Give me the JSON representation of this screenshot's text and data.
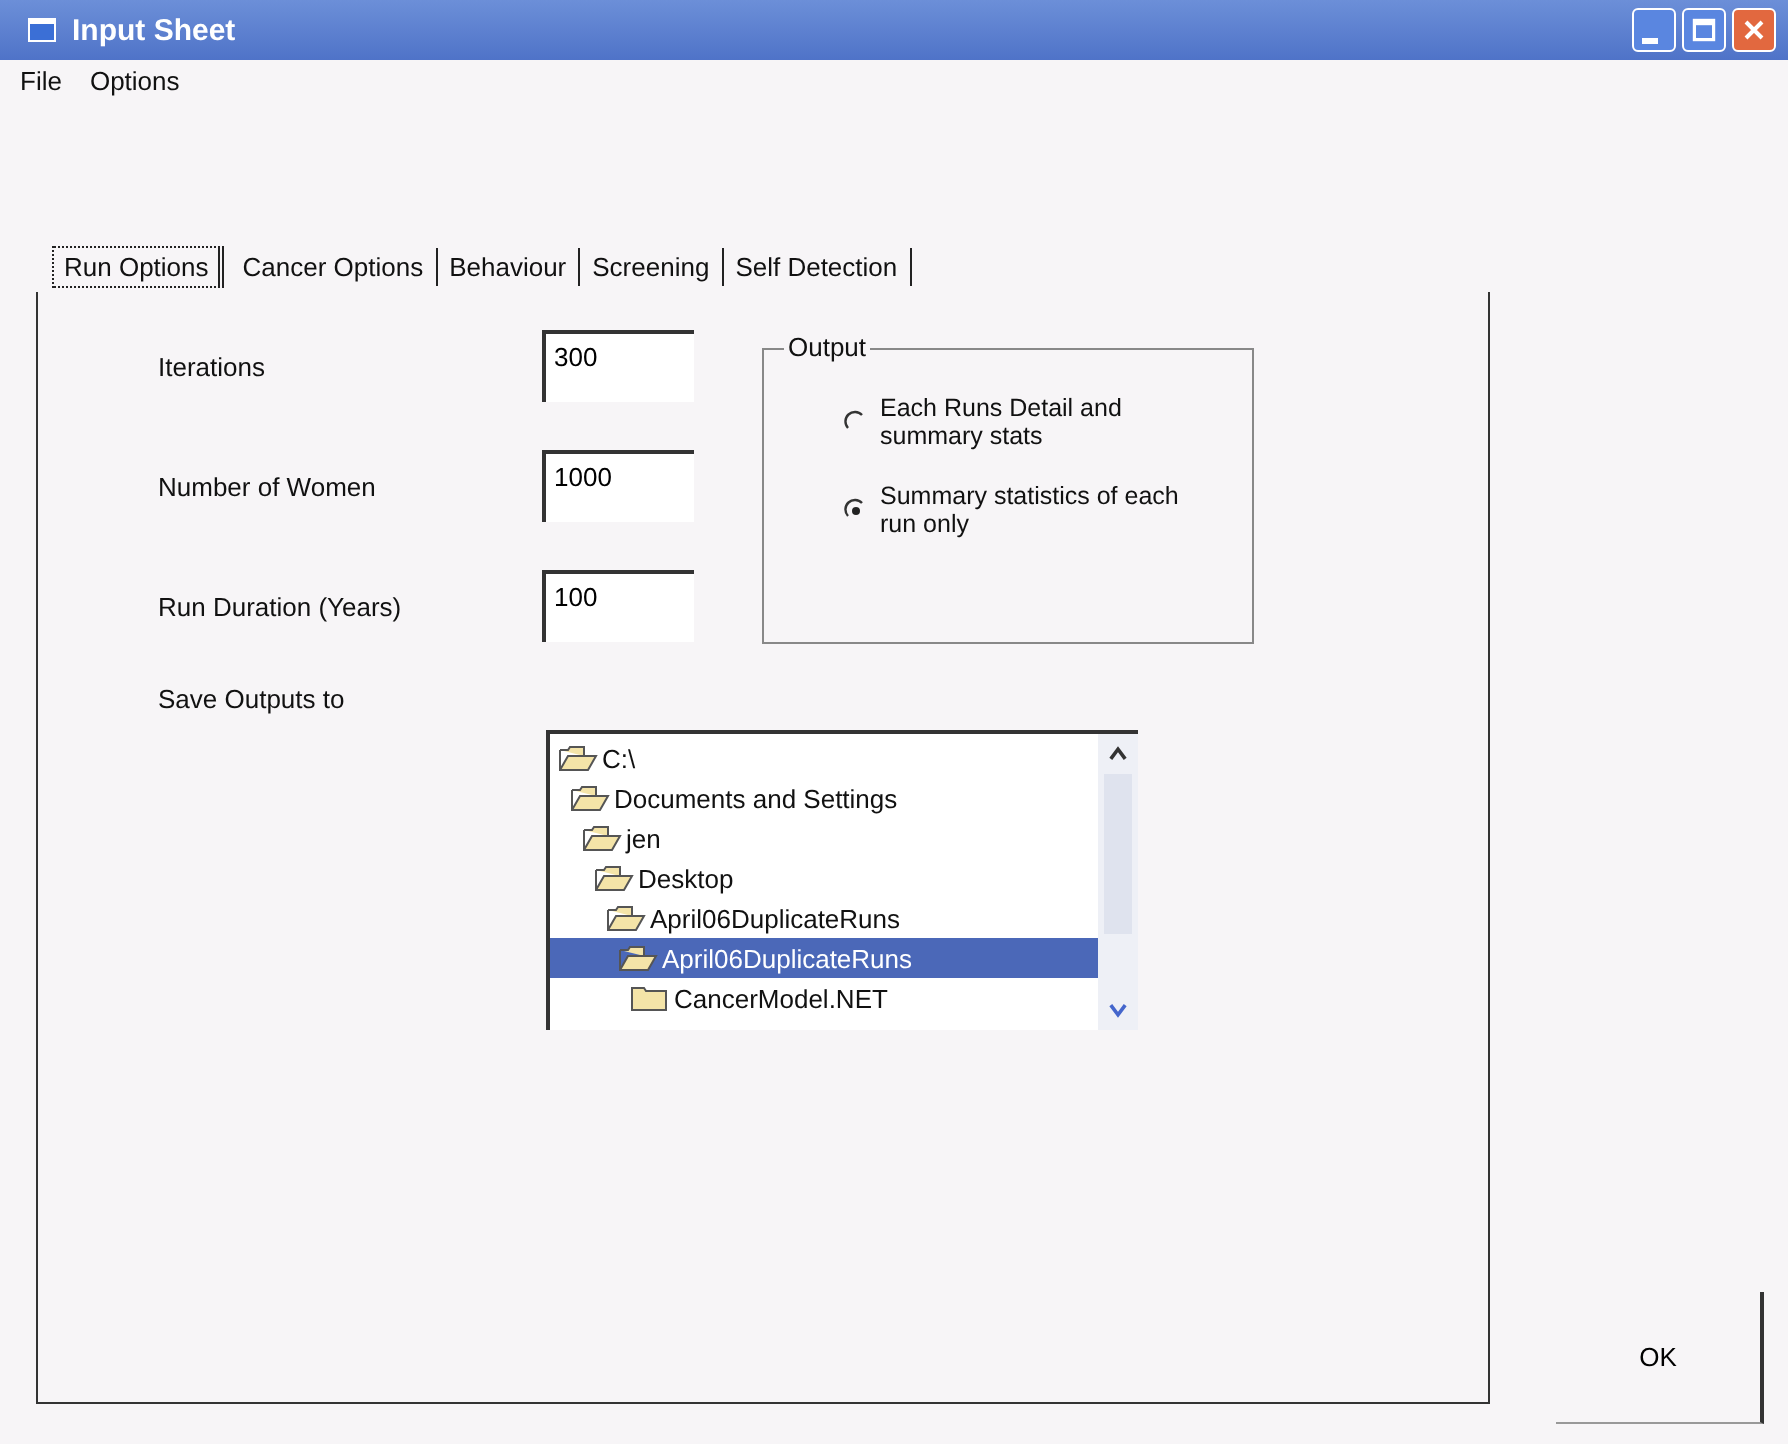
{
  "window": {
    "title": "Input Sheet"
  },
  "menu": [
    "File",
    "Options"
  ],
  "tabs": [
    {
      "label": "Run Options",
      "selected": true
    },
    {
      "label": "Cancer Options",
      "selected": false
    },
    {
      "label": "Behaviour",
      "selected": false
    },
    {
      "label": "Screening",
      "selected": false
    },
    {
      "label": "Self Detection",
      "selected": false
    }
  ],
  "fields": [
    {
      "label": "Iterations",
      "value": "300"
    },
    {
      "label": "Number of Women",
      "value": "1000"
    },
    {
      "label": "Run Duration (Years)",
      "value": "100"
    }
  ],
  "output": {
    "title": "Output",
    "options": [
      {
        "label": "Each Runs Detail and summary stats",
        "selected": false
      },
      {
        "label": "Summary statistics of each run only",
        "selected": true
      }
    ]
  },
  "save": {
    "label": "Save Outputs to",
    "folders": [
      {
        "name": "C:\\",
        "kind": "open",
        "selected": false,
        "children": [
          {
            "name": "Documents and Settings",
            "kind": "open",
            "selected": false,
            "children": [
              {
                "name": "jen",
                "kind": "open",
                "selected": false,
                "children": [
                  {
                    "name": "Desktop",
                    "kind": "open",
                    "selected": false,
                    "children": [
                      {
                        "name": "April06DuplicateRuns",
                        "kind": "open",
                        "selected": false,
                        "children": [
                          {
                            "name": "April06DuplicateRuns",
                            "kind": "open",
                            "selected": true,
                            "children": [
                              {
                                "name": "CancerModel.NET",
                                "kind": "closed",
                                "selected": false
                              }
                            ]
                          }
                        ]
                      }
                    ]
                  }
                ]
              }
            ]
          }
        ]
      }
    ]
  },
  "ok_button": "OK"
}
